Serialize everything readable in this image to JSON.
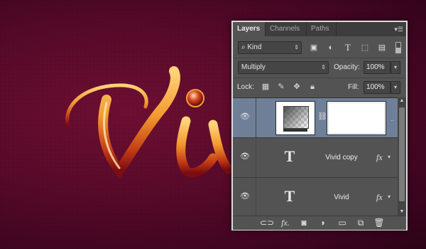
{
  "canvas": {
    "text": "Vivid",
    "accent_colors": [
      "#f2a13a",
      "#c8471a",
      "#8e0f1a"
    ]
  },
  "layers_panel": {
    "tabs": [
      {
        "label": "Layers",
        "active": true
      },
      {
        "label": "Channels",
        "active": false
      },
      {
        "label": "Paths",
        "active": false
      }
    ],
    "filter": {
      "kind_label": "Kind",
      "icons": [
        "image-filter-icon",
        "adjustment-filter-icon",
        "type-filter-icon",
        "shape-filter-icon",
        "smart-object-filter-icon"
      ]
    },
    "blend_mode": "Multiply",
    "opacity_label": "Opacity:",
    "opacity_value": "100%",
    "lock_label": "Lock:",
    "fill_label": "Fill:",
    "fill_value": "100%",
    "layers": [
      {
        "type": "gradient-map-adjustment",
        "name": "",
        "visible": true,
        "selected": true
      },
      {
        "type": "text",
        "name": "Vivid copy",
        "visible": true,
        "selected": false,
        "has_fx": true,
        "fx_label": "fx"
      },
      {
        "type": "text",
        "name": "Vivid",
        "visible": true,
        "selected": false,
        "has_fx": true,
        "fx_label": "fx"
      }
    ],
    "text_icon_glyph": "T",
    "bottom_icons": [
      "link-layers-icon",
      "add-layer-style-icon",
      "add-mask-icon",
      "new-fill-adjustment-icon",
      "new-group-icon",
      "new-layer-icon",
      "delete-layer-icon"
    ]
  }
}
